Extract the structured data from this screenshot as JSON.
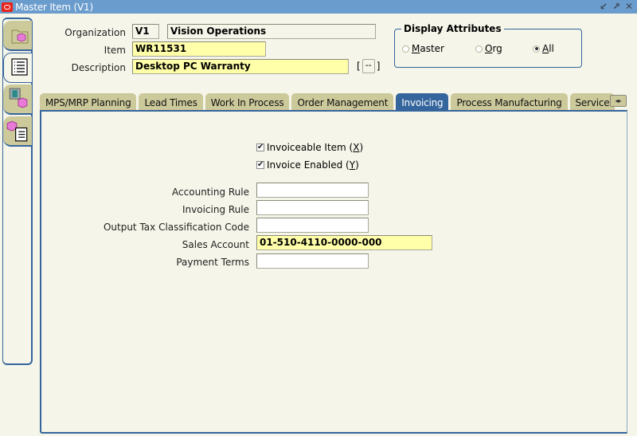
{
  "window": {
    "title": "Master Item (V1)",
    "controls": [
      "minimize-icon",
      "maximize-icon",
      "close-icon"
    ]
  },
  "side_tabs": [
    {
      "name": "item-folder",
      "icon": "folder-cube-icon",
      "active": false
    },
    {
      "name": "item-list",
      "icon": "list-icon",
      "active": true
    },
    {
      "name": "item-organization",
      "icon": "building-cube-icon",
      "active": false
    },
    {
      "name": "item-attributes",
      "icon": "cube-list-icon",
      "active": false
    }
  ],
  "header": {
    "organization_label": "Organization",
    "organization_code": "V1",
    "organization_name": "Vision Operations",
    "item_label": "Item",
    "item_value": "WR11531",
    "description_label": "Description",
    "description_value": "Desktop PC Warranty",
    "dots_button": "--",
    "bracket_open": "[",
    "bracket_close": "]"
  },
  "display_attributes": {
    "title": "Display Attributes",
    "options": [
      {
        "label_prefix": "",
        "mnemonic": "M",
        "label_rest": "aster",
        "selected": false
      },
      {
        "label_prefix": "",
        "mnemonic": "O",
        "label_rest": "rg",
        "selected": false
      },
      {
        "label_prefix": "",
        "mnemonic": "A",
        "label_rest": "ll",
        "selected": true
      }
    ]
  },
  "tabs": [
    {
      "label": "MPS/MRP Planning",
      "active": false
    },
    {
      "label": "Lead Times",
      "active": false
    },
    {
      "label": "Work In Process",
      "active": false
    },
    {
      "label": "Order Management",
      "active": false
    },
    {
      "label": "Invoicing",
      "active": true
    },
    {
      "label": "Process Manufacturing",
      "active": false
    },
    {
      "label": "Service",
      "active": false
    }
  ],
  "tab_scroll": "◂▸",
  "invoicing": {
    "checkboxes": [
      {
        "label": "Invoiceable Item (",
        "mnemonic": "X",
        "suffix": ")",
        "checked": true
      },
      {
        "label": "Invoice Enabled (",
        "mnemonic": "Y",
        "suffix": ")",
        "checked": true
      }
    ],
    "fields": [
      {
        "label": "Accounting Rule",
        "value": "",
        "required": false
      },
      {
        "label": "Invoicing Rule",
        "value": "",
        "required": false
      },
      {
        "label": "Output Tax Classification Code",
        "value": "",
        "required": false
      },
      {
        "label": "Sales Account",
        "value": "01-510-4110-0000-000",
        "required": true
      },
      {
        "label": "Payment Terms",
        "value": "",
        "required": false
      }
    ]
  },
  "check_glyph": "✔"
}
